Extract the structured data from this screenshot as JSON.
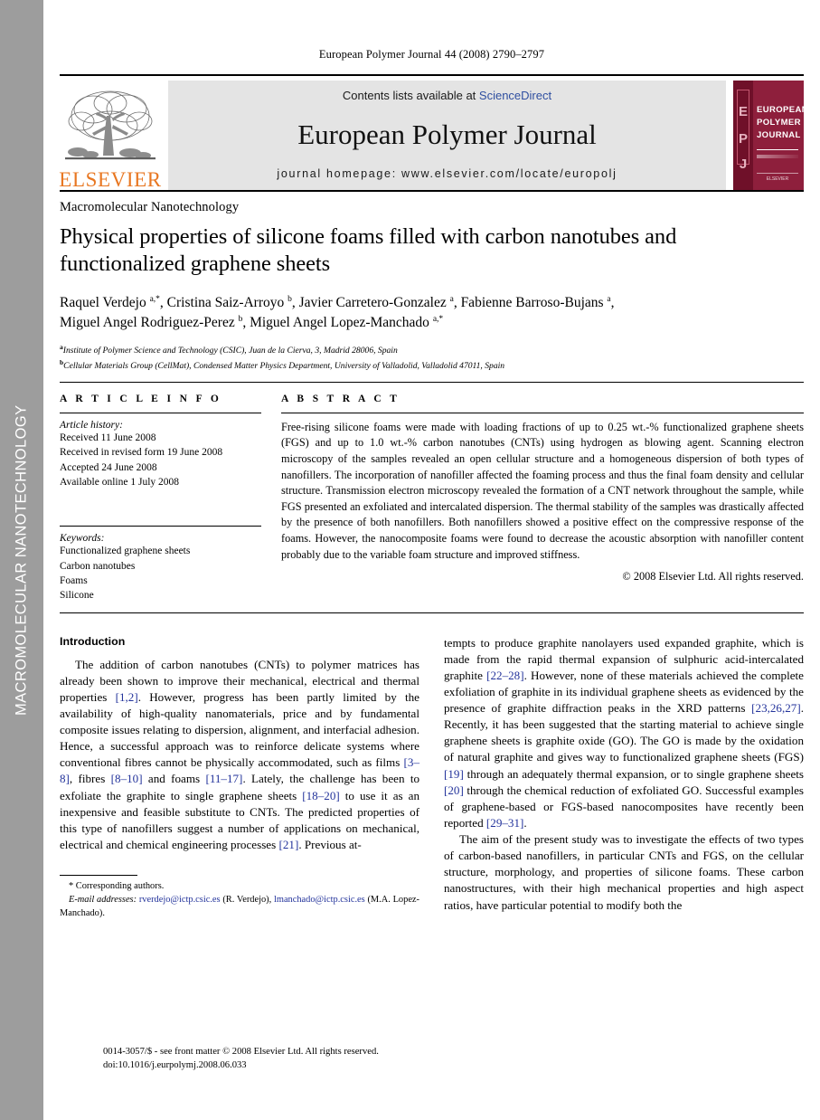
{
  "side_rail": {
    "label": "MACROMOLECULAR NANOTECHNOLOGY",
    "bg_color": "#9d9d9d",
    "text_color": "#ffffff"
  },
  "running_head": "European Polymer Journal 44 (2008) 2790–2797",
  "masthead": {
    "publisher_wordmark": "ELSEVIER",
    "publisher_color": "#E87722",
    "contents_prefix": "Contents lists available at ",
    "sciencedirect": "ScienceDirect",
    "sciencedirect_color": "#2f4fa0",
    "journal_title": "European Polymer Journal",
    "homepage": "journal homepage: www.elsevier.com/locate/europolj",
    "banner_bg": "#e4e4e4",
    "cover": {
      "line1": "EUROPEAN",
      "line2": "POLYMER",
      "line3": "JOURNAL",
      "spine_letters": [
        "E",
        "P",
        "J"
      ],
      "bg_color": "#8e1f3c",
      "footer": "ELSEVIER"
    }
  },
  "article": {
    "section_label": "Macromolecular Nanotechnology",
    "title": "Physical properties of silicone foams filled with carbon nanotubes and functionalized graphene sheets",
    "authors_line1": "Raquel Verdejo a,*, Cristina Saiz-Arroyo b, Javier Carretero-Gonzalez a, Fabienne Barroso-Bujans a,",
    "authors_line2": "Miguel Angel Rodriguez-Perez b, Miguel Angel Lopez-Manchado a,*",
    "affiliations": [
      {
        "marker": "a",
        "text": "Institute of Polymer Science and Technology (CSIC), Juan de la Cierva, 3, Madrid 28006, Spain"
      },
      {
        "marker": "b",
        "text": "Cellular Materials Group (CellMat), Condensed Matter Physics Department, University of Valladolid, Valladolid 47011, Spain"
      }
    ]
  },
  "article_info": {
    "heading": "A R T I C L E    I N F O",
    "history_label": "Article history:",
    "history": [
      "Received 11 June 2008",
      "Received in revised form 19 June 2008",
      "Accepted 24 June 2008",
      "Available online 1 July 2008"
    ],
    "keywords_label": "Keywords:",
    "keywords": [
      "Functionalized graphene sheets",
      "Carbon nanotubes",
      "Foams",
      "Silicone"
    ]
  },
  "abstract": {
    "heading": "A B S T R A C T",
    "text": "Free-rising silicone foams were made with loading fractions of up to 0.25 wt.-% functionalized graphene sheets (FGS) and up to 1.0 wt.-% carbon nanotubes (CNTs) using hydrogen as blowing agent. Scanning electron microscopy of the samples revealed an open cellular structure and a homogeneous dispersion of both types of nanofillers. The incorporation of nanofiller affected the foaming process and thus the final foam density and cellular structure. Transmission electron microscopy revealed the formation of a CNT network throughout the sample, while FGS presented an exfoliated and intercalated dispersion. The thermal stability of the samples was drastically affected by the presence of both nanofillers. Both nanofillers showed a positive effect on the compressive response of the foams. However, the nanocomposite foams were found to decrease the acoustic absorption with nanofiller content probably due to the variable foam structure and improved stiffness.",
    "copyright": "© 2008 Elsevier Ltd. All rights reserved."
  },
  "body": {
    "intro_heading": "Introduction",
    "left_paragraph_parts": [
      "The addition of carbon nanotubes (CNTs) to polymer matrices has already been shown to improve their mechanical, electrical and thermal properties ",
      "[1,2]",
      ". However, progress has been partly limited by the availability of high-quality nanomaterials, price and by fundamental composite issues relating to dispersion, alignment, and interfacial adhesion. Hence, a successful approach was to reinforce delicate systems where conventional fibres cannot be physically accommodated, such as films ",
      "[3–8]",
      ", fibres ",
      "[8–10]",
      " and foams ",
      "[11–17]",
      ". Lately, the challenge has been to exfoliate the graphite to single graphene sheets ",
      "[18–20]",
      " to use it as an inexpensive and feasible substitute to CNTs. The predicted properties of this type of nanofillers suggest a number of applications on mechanical, electrical and chemical engineering processes ",
      "[21]",
      ". Previous at-"
    ],
    "right_paragraph1_parts": [
      "tempts to produce graphite nanolayers used expanded graphite, which is made from the rapid thermal expansion of sulphuric acid-intercalated graphite ",
      "[22–28]",
      ". However, none of these materials achieved the complete exfoliation of graphite in its individual graphene sheets as evidenced by the presence of graphite diffraction peaks in the XRD patterns ",
      "[23,26,27]",
      ". Recently, it has been suggested that the starting material to achieve single graphene sheets is graphite oxide (GO). The GO is made by the oxidation of natural graphite and gives way to functionalized graphene sheets (FGS) ",
      "[19]",
      " through an adequately thermal expansion, or to single graphene sheets ",
      "[20]",
      " through the chemical reduction of exfoliated GO. Successful examples of graphene-based or FGS-based nanocomposites have recently been reported ",
      "[29–31]",
      "."
    ],
    "right_paragraph2": "The aim of the present study was to investigate the effects of two types of carbon-based nanofillers, in particular CNTs and FGS, on the cellular structure, morphology, and properties of silicone foams. These carbon nanostructures, with their high mechanical properties and high aspect ratios, have particular potential to modify both the",
    "citation_color": "#23339b"
  },
  "footnote": {
    "corresponding": "* Corresponding authors.",
    "email_label": "E-mail addresses:",
    "email1": "rverdejo@ictp.csic.es",
    "email1_owner": "(R. Verdejo),",
    "email2": "lmanchado@ictp.csic.es",
    "email2_owner": "(M.A. Lopez-Manchado)."
  },
  "issn_footer": {
    "line1": "0014-3057/$ - see front matter © 2008 Elsevier Ltd. All rights reserved.",
    "line2": "doi:10.1016/j.eurpolymj.2008.06.033"
  }
}
